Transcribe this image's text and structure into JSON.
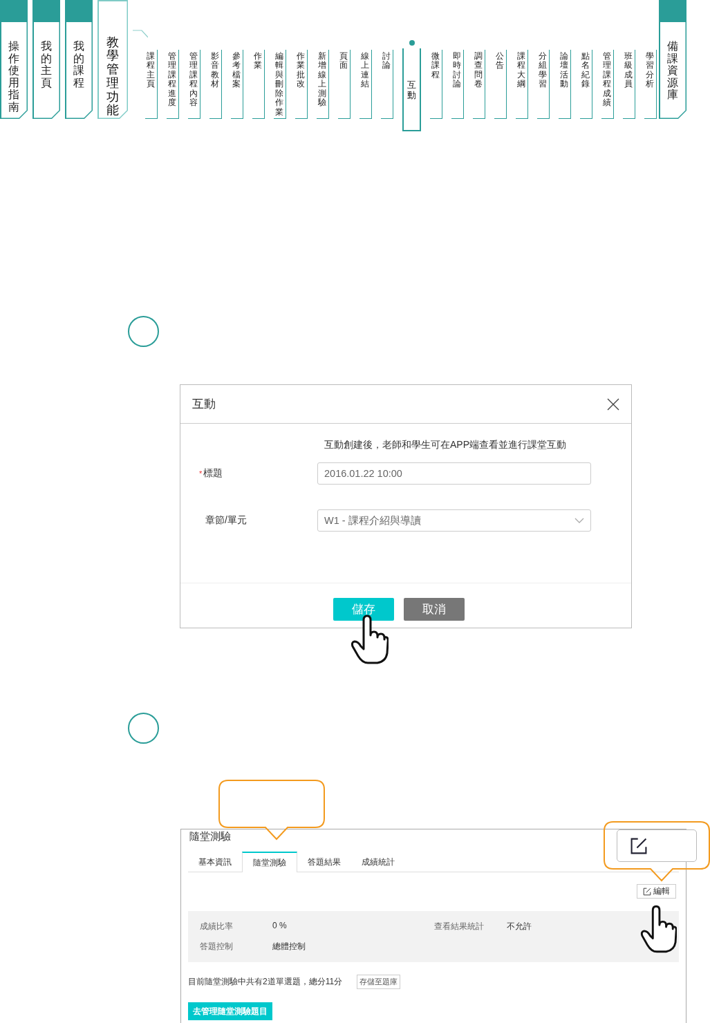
{
  "nav": {
    "main_tabs": [
      {
        "label": "操作使用指南",
        "selected": false
      },
      {
        "label": "我的主頁",
        "selected": false
      },
      {
        "label": "我的課程",
        "selected": false
      },
      {
        "label": "教學管理功能",
        "selected": true
      }
    ],
    "sub_items": [
      {
        "label": "課程主頁",
        "selected": false
      },
      {
        "label": "管理課程進度",
        "selected": false
      },
      {
        "label": "管理課程內容",
        "selected": false
      },
      {
        "label": "影音教材",
        "selected": false
      },
      {
        "label": "參考檔案",
        "selected": false
      },
      {
        "label": "作業",
        "selected": false
      },
      {
        "label": "編輯與刪除作業",
        "selected": false
      },
      {
        "label": "作業批改",
        "selected": false
      },
      {
        "label": "新增線上測驗",
        "selected": false
      },
      {
        "label": "頁面",
        "selected": false
      },
      {
        "label": "線上連結",
        "selected": false
      },
      {
        "label": "討論",
        "selected": false
      },
      {
        "label": "互動",
        "selected": true
      },
      {
        "label": "微課程",
        "selected": false
      },
      {
        "label": "即時討論",
        "selected": false
      },
      {
        "label": "調查問卷",
        "selected": false
      },
      {
        "label": "公告",
        "selected": false
      },
      {
        "label": "課程大綱",
        "selected": false
      },
      {
        "label": "分組學習",
        "selected": false
      },
      {
        "label": "論壇活動",
        "selected": false
      },
      {
        "label": "點名紀錄",
        "selected": false
      },
      {
        "label": "管理課程成績",
        "selected": false
      },
      {
        "label": "班級成員",
        "selected": false
      },
      {
        "label": "學習分析",
        "selected": false
      }
    ],
    "end_tabs": [
      {
        "label": "備課資源庫",
        "selected": false
      }
    ]
  },
  "dialog": {
    "title": "互動",
    "notice": "互動創建後，老師和學生可在APP端查看並進行課堂互動",
    "fields": [
      {
        "kind": "text",
        "marker": "*",
        "label": "標題",
        "value": "2016.01.22 10:00"
      },
      {
        "kind": "select",
        "label": "章節/單元",
        "value": "W1 - 課程介紹與導讀"
      }
    ],
    "buttons": [
      {
        "kind": "primary",
        "label": "儲存"
      },
      {
        "kind": "secondary",
        "label": "取消"
      }
    ]
  },
  "quiz_panel": {
    "title": "隨堂測驗",
    "tabs": [
      {
        "label": "基本資訊",
        "selected": false
      },
      {
        "label": "隨堂測驗",
        "selected": true
      },
      {
        "label": "答題結果",
        "selected": false
      },
      {
        "label": "成績統計",
        "selected": false
      }
    ],
    "edit_button": "編輯",
    "info": [
      {
        "label": "成績比率",
        "value": "0 %"
      },
      {
        "label": "查看結果統計",
        "value": "不允許"
      },
      {
        "label": "答題控制",
        "value": "總體控制"
      }
    ],
    "summary": "目前隨堂測驗中共有2道單選題，總分11分",
    "save_button": "存儲至題庫",
    "manage_button": "去管理隨堂測驗題目"
  }
}
